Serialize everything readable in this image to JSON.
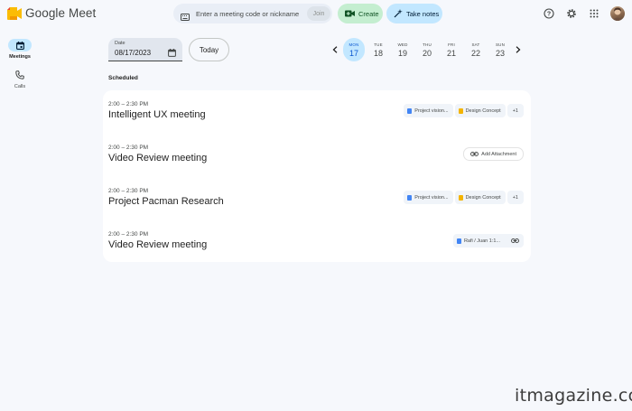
{
  "app": {
    "title": "Google Meet"
  },
  "header": {
    "meeting_code_placeholder": "Enter a meeting code or nickname",
    "join_label": "Join",
    "create_label": "Create",
    "take_notes_label": "Take notes",
    "icons": [
      "help-icon",
      "settings-icon",
      "apps-grid-icon",
      "avatar"
    ]
  },
  "rail": {
    "items": [
      {
        "label": "Meetings",
        "icon": "calendar-icon",
        "active": true
      },
      {
        "label": "Calls",
        "icon": "phone-icon",
        "active": false
      }
    ]
  },
  "date_picker": {
    "label": "Date",
    "value": "08/17/2023"
  },
  "today_label": "Today",
  "week": [
    {
      "name": "MON",
      "num": "17",
      "active": true
    },
    {
      "name": "TUE",
      "num": "18",
      "active": false
    },
    {
      "name": "WED",
      "num": "19",
      "active": false
    },
    {
      "name": "THU",
      "num": "20",
      "active": false
    },
    {
      "name": "FRI",
      "num": "21",
      "active": false
    },
    {
      "name": "SAT",
      "num": "22",
      "active": false
    },
    {
      "name": "SUN",
      "num": "23",
      "active": false
    }
  ],
  "section_title": "Scheduled",
  "meetings": [
    {
      "time": "2:00 – 2:30 PM",
      "title": "Intelligent UX meeting",
      "attachments": {
        "doc": "Project vision...",
        "slides": "Design Concept",
        "more": "+1"
      }
    },
    {
      "time": "2:00 – 2:30 PM",
      "title": "Video Review meeting",
      "add_attachment": "Add Attachment"
    },
    {
      "time": "2:00 – 2:30 PM",
      "title": "Project Pacman Research",
      "attachments": {
        "doc": "Project vision...",
        "slides": "Design Concept",
        "more": "+1"
      }
    },
    {
      "time": "2:00 – 2:30 PM",
      "title": "Video Review meeting",
      "attachments": {
        "doc": "Rafi / Juan 1:1..."
      }
    }
  ],
  "colors": {
    "accent": "#0b57d0",
    "create_bg": "#c4eed0",
    "notes_bg": "#c2e7ff",
    "doc_blue": "#4285f4",
    "slides_yellow": "#f4b400"
  },
  "watermark": "itmagazine.cc"
}
